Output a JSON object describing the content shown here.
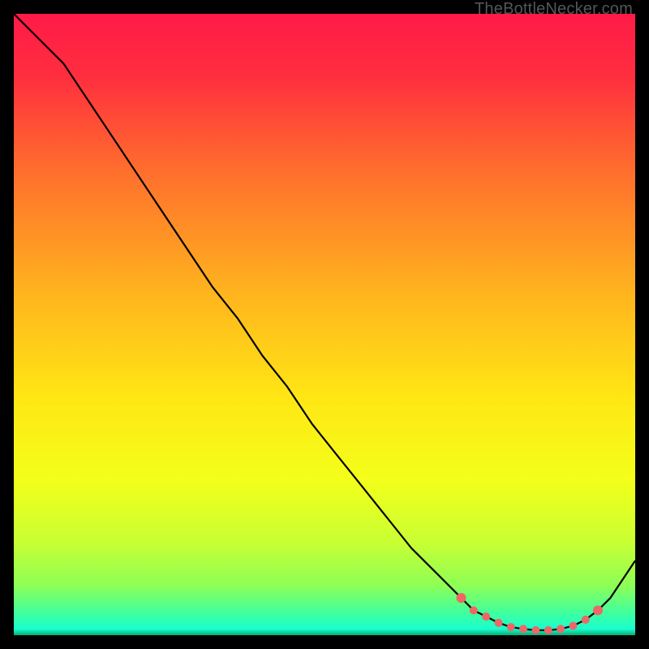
{
  "attribution": "TheBottleNecker.com",
  "chart_data": {
    "type": "line",
    "title": "",
    "xlabel": "",
    "ylabel": "",
    "xlim": [
      0,
      100
    ],
    "ylim": [
      0,
      100
    ],
    "series": [
      {
        "name": "bottleneck-curve",
        "x": [
          0,
          4,
          8,
          12,
          16,
          20,
          24,
          28,
          32,
          36,
          40,
          44,
          48,
          52,
          56,
          60,
          64,
          68,
          72,
          74,
          76,
          78,
          80,
          82,
          84,
          86,
          88,
          90,
          92,
          94,
          96,
          98,
          100
        ],
        "y": [
          100,
          96,
          92,
          86,
          80,
          74,
          68,
          62,
          56,
          51,
          45,
          40,
          34,
          29,
          24,
          19,
          14,
          10,
          6,
          4,
          3,
          2,
          1.3,
          1,
          0.8,
          0.8,
          1,
          1.5,
          2.5,
          4,
          6,
          9,
          12
        ]
      }
    ],
    "markers": {
      "name": "highlight-points",
      "x": [
        72,
        74,
        76,
        78,
        80,
        82,
        84,
        86,
        88,
        90,
        92,
        94
      ],
      "y": [
        6,
        4,
        3,
        2,
        1.3,
        1,
        0.8,
        0.8,
        1,
        1.5,
        2.5,
        4
      ]
    },
    "gradient_stops": [
      {
        "offset": 0.0,
        "color": "#ff1a47"
      },
      {
        "offset": 0.1,
        "color": "#ff2e3f"
      },
      {
        "offset": 0.25,
        "color": "#ff6d2d"
      },
      {
        "offset": 0.45,
        "color": "#ffb41e"
      },
      {
        "offset": 0.62,
        "color": "#ffe714"
      },
      {
        "offset": 0.75,
        "color": "#f3ff1a"
      },
      {
        "offset": 0.85,
        "color": "#c9ff33"
      },
      {
        "offset": 0.92,
        "color": "#8dff55"
      },
      {
        "offset": 0.965,
        "color": "#3effa0"
      },
      {
        "offset": 0.99,
        "color": "#18ffce"
      },
      {
        "offset": 1.0,
        "color": "#05ab74"
      }
    ]
  }
}
